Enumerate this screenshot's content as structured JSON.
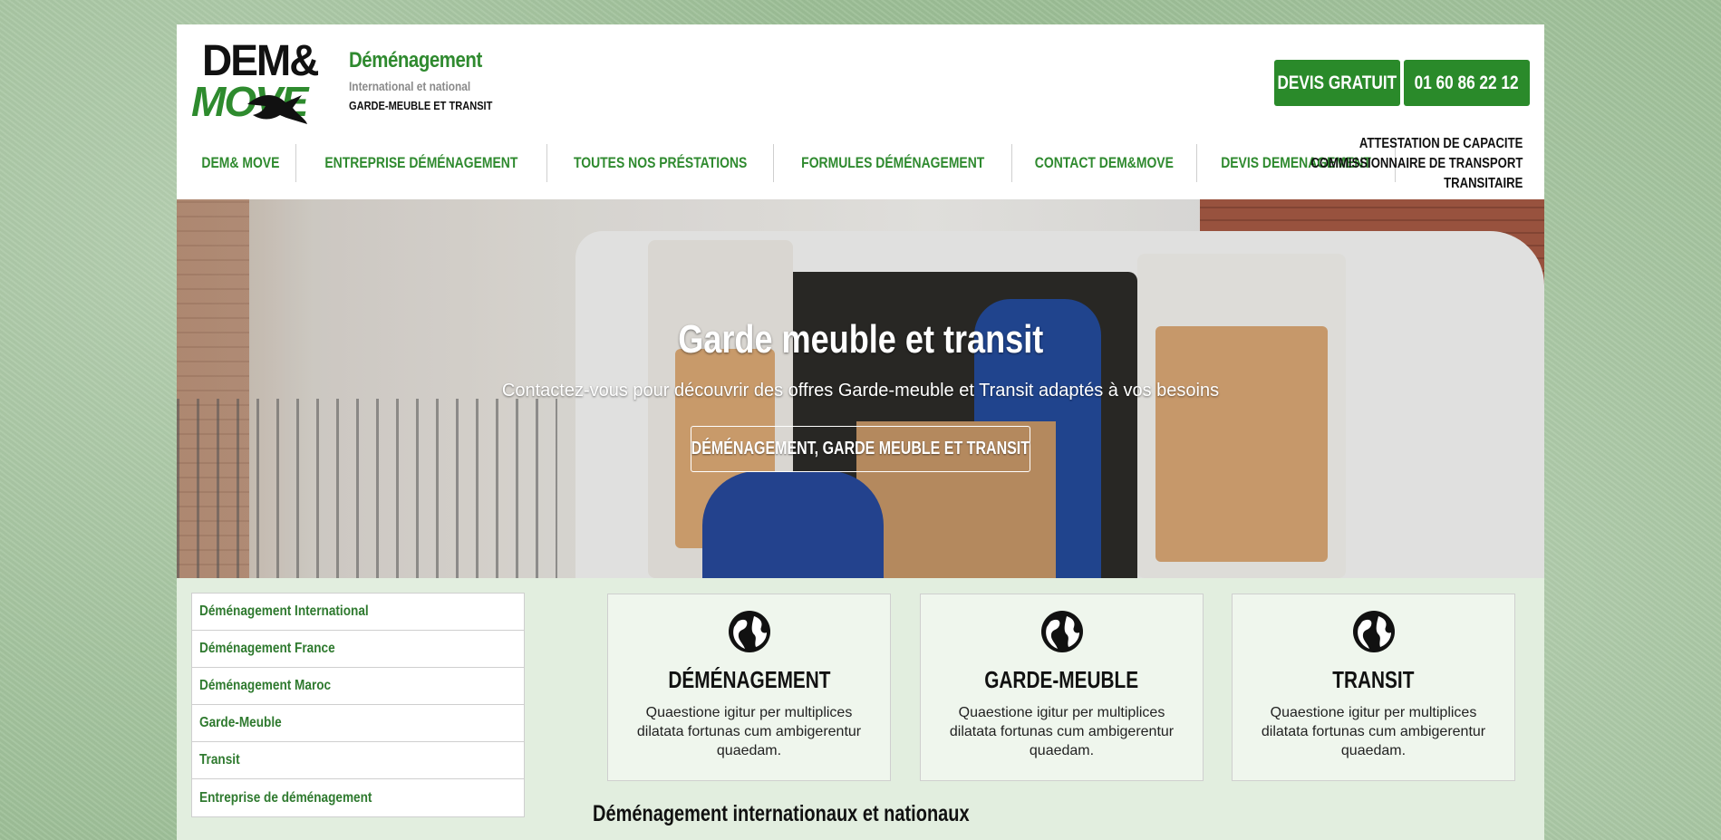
{
  "brand": {
    "logo_top": "DEM&",
    "logo_bottom": "MOVE",
    "title": "Déménagement",
    "subtitle": "International et national",
    "subtitle2": "GARDE-MEUBLE ET TRANSIT"
  },
  "header": {
    "devis_label": "DEVIS GRATUIT",
    "phone_label": "01 60 86 22 12",
    "accent_color": "#2a8a2a"
  },
  "nav": {
    "items": [
      {
        "label": "DEM& MOVE"
      },
      {
        "label": "ENTREPRISE DÉMÉNAGEMENT"
      },
      {
        "label": "TOUTES NOS PRÉSTATIONS"
      },
      {
        "label": "FORMULES DÉMÉNAGEMENT"
      },
      {
        "label": "CONTACT DEM&MOVE"
      },
      {
        "label": "DEVIS DEMENAGEMENT"
      }
    ]
  },
  "right_info": {
    "line1": "ATTESTATION DE CAPACITE",
    "line2": "COMMISSIONNAIRE DE TRANSPORT",
    "line3": "TRANSITAIRE"
  },
  "hero": {
    "title": "Garde meuble et transit",
    "subtitle": "Contactez-vous pour découvrir des offres Garde-meuble et Transit adaptés à vos besoins",
    "button_label": "DÉMÉNAGEMENT, GARDE MEUBLE ET TRANSIT"
  },
  "sidebar": {
    "items": [
      {
        "label": "Déménagement International"
      },
      {
        "label": "Déménagement France"
      },
      {
        "label": "Déménagement Maroc"
      },
      {
        "label": "Garde-Meuble"
      },
      {
        "label": "Transit"
      },
      {
        "label": "Entreprise de déménagement"
      }
    ]
  },
  "cards": [
    {
      "icon": "globe-icon",
      "title": "DÉMÉNAGEMENT",
      "text": "Quaestione igitur per multiplices dilatata fortunas cum ambigerentur quaedam."
    },
    {
      "icon": "globe-icon",
      "title": "GARDE-MEUBLE",
      "text": "Quaestione igitur per multiplices dilatata fortunas cum ambigerentur quaedam."
    },
    {
      "icon": "globe-icon",
      "title": "TRANSIT",
      "text": "Quaestione igitur per multiplices dilatata fortunas cum ambigerentur quaedam."
    }
  ],
  "section": {
    "title": "Déménagement internationaux et nationaux"
  }
}
